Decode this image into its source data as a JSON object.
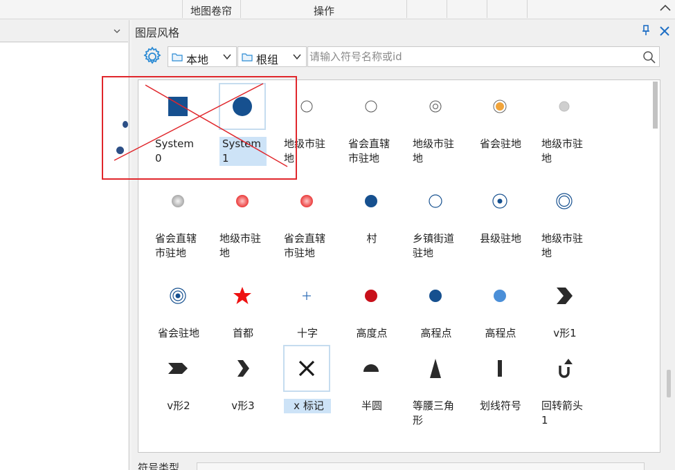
{
  "topbar": {
    "tab_map_curtain": "地图卷帘",
    "tab_operation": "操作"
  },
  "panel": {
    "title": "图层风格"
  },
  "toolbar": {
    "source_select": "本地",
    "group_select": "根组",
    "search_placeholder": "请输入符号名称或id"
  },
  "symbols": [
    {
      "name": "System 0",
      "icon": "filled-square-icon",
      "selected": false
    },
    {
      "name": "System 1",
      "icon": "filled-circle-icon",
      "selected": true
    },
    {
      "name": "地级市驻地",
      "icon": "hollow-circle-icon",
      "selected": false
    },
    {
      "name": "省会直辖市驻地",
      "icon": "hollow-circle-icon",
      "selected": false
    },
    {
      "name": "地级市驻地",
      "icon": "double-circle-icon",
      "selected": false
    },
    {
      "name": "省会驻地",
      "icon": "orange-dot-circle-icon",
      "selected": false
    },
    {
      "name": "地级市驻地",
      "icon": "gray-dot-icon",
      "selected": false
    },
    {
      "name": "省会直辖市驻地",
      "icon": "gray-sphere-icon",
      "selected": false
    },
    {
      "name": "地级市驻地",
      "icon": "red-sphere-icon",
      "selected": false
    },
    {
      "name": "省会直辖市驻地",
      "icon": "red-sphere-icon",
      "selected": false
    },
    {
      "name": "村",
      "icon": "blue-dot-icon",
      "selected": false
    },
    {
      "name": "乡镇街道驻地",
      "icon": "blue-ring-icon",
      "selected": false
    },
    {
      "name": "县级驻地",
      "icon": "dot-in-circle-icon",
      "selected": false
    },
    {
      "name": "地级市驻地",
      "icon": "double-ring-icon",
      "selected": false
    },
    {
      "name": "省会驻地",
      "icon": "triple-ring-icon",
      "selected": false
    },
    {
      "name": "首都",
      "icon": "red-star-icon",
      "selected": false
    },
    {
      "name": "十字",
      "icon": "cross-icon",
      "selected": false
    },
    {
      "name": "高度点",
      "icon": "red-dot-icon",
      "selected": false
    },
    {
      "name": "高程点",
      "icon": "navy-dot-icon",
      "selected": false
    },
    {
      "name": "高程点",
      "icon": "light-blue-dot-icon",
      "selected": false
    },
    {
      "name": "v形1",
      "icon": "chevron-bold-icon",
      "selected": false
    },
    {
      "name": "v形2",
      "icon": "chevron-arrow-icon",
      "selected": false
    },
    {
      "name": "v形3",
      "icon": "chevron-thin-icon",
      "selected": false
    },
    {
      "name": "x 标记",
      "icon": "x-mark-icon",
      "selected": true
    },
    {
      "name": "半圆",
      "icon": "half-circle-icon",
      "selected": false
    },
    {
      "name": "等腰三角形",
      "icon": "isosceles-triangle-icon",
      "selected": false
    },
    {
      "name": "划线符号",
      "icon": "bar-line-icon",
      "selected": false
    },
    {
      "name": "回转箭头1",
      "icon": "u-turn-arrow-icon",
      "selected": false
    }
  ],
  "bottom": {
    "label": "符号类型"
  },
  "colors": {
    "accent": "#1f6fc5",
    "selection": "#cde3f7",
    "annotation": "#e0262b"
  }
}
